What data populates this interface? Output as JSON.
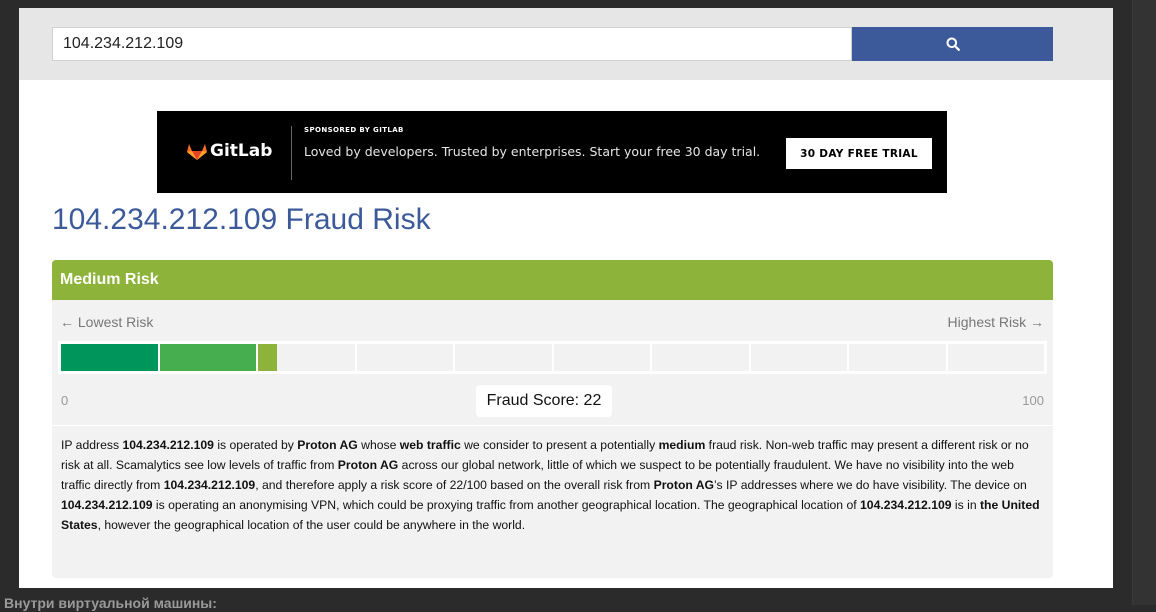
{
  "search": {
    "value": "104.234.212.109",
    "button_icon": "search-icon"
  },
  "ad": {
    "logo_text": "GitLab",
    "logo_icon": "gitlab-fox-icon",
    "sponsor": "SPONSORED BY GITLAB",
    "text": "Loved by developers. Trusted by enterprises. Start your free 30 day trial.",
    "cta": "30 DAY FREE TRIAL"
  },
  "title": "104.234.212.109 Fraud Risk",
  "risk": {
    "level": "Medium Risk",
    "low_label": "← Lowest Risk",
    "high_label": "Highest Risk →",
    "min": "0",
    "max": "100",
    "score_label": "Fraud Score: 22",
    "score": 22,
    "segment_colors": [
      "#00955a",
      "#46ae4e",
      "#8db33a"
    ]
  },
  "description": {
    "segments": [
      {
        "t": "IP address ",
        "b": false
      },
      {
        "t": "104.234.212.109",
        "b": true
      },
      {
        "t": " is operated by ",
        "b": false
      },
      {
        "t": "Proton AG",
        "b": true
      },
      {
        "t": " whose ",
        "b": false
      },
      {
        "t": "web traffic",
        "b": true
      },
      {
        "t": " we consider to present a potentially ",
        "b": false
      },
      {
        "t": "medium",
        "b": true
      },
      {
        "t": " fraud risk. Non-web traffic may present a different risk or no risk at all. Scamalytics see low levels of traffic from ",
        "b": false
      },
      {
        "t": "Proton AG",
        "b": true
      },
      {
        "t": " across our global network, little of which we suspect to be potentially fraudulent. We have no visibility into the web traffic directly from ",
        "b": false
      },
      {
        "t": "104.234.212.109",
        "b": true
      },
      {
        "t": ", and therefore apply a risk score of 22/100 based on the overall risk from ",
        "b": false
      },
      {
        "t": "Proton AG",
        "b": true
      },
      {
        "t": "’s IP addresses where we do have visibility. The device on ",
        "b": false
      },
      {
        "t": "104.234.212.109",
        "b": true
      },
      {
        "t": " is operating an anonymising VPN, which could be proxying traffic from another geographical location. The geographical location of ",
        "b": false
      },
      {
        "t": "104.234.212.109",
        "b": true
      },
      {
        "t": " is in ",
        "b": false
      },
      {
        "t": "the United States",
        "b": true
      },
      {
        "t": ", however the geographical location of the user could be anywhere in the world.",
        "b": false
      }
    ]
  },
  "caption": "Внутри виртуальной машины:"
}
